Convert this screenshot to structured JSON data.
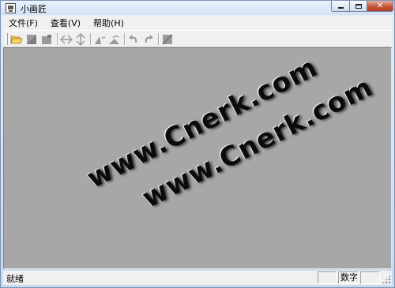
{
  "window": {
    "title": "小画匠"
  },
  "menu": {
    "items": [
      "文件(F)",
      "查看(V)",
      "帮助(H)"
    ]
  },
  "toolbar": {
    "buttons": [
      {
        "name": "open-icon"
      },
      {
        "name": "save-icon"
      },
      {
        "name": "save-as-icon"
      },
      {
        "name": "flip-horizontal-icon"
      },
      {
        "name": "flip-vertical-icon"
      },
      {
        "name": "rotate-left-icon"
      },
      {
        "name": "rotate-right-icon"
      },
      {
        "name": "undo-icon"
      },
      {
        "name": "redo-icon"
      },
      {
        "name": "crop-icon"
      }
    ]
  },
  "canvas": {
    "background": "#a7a7a7",
    "watermark_1": "www.Cnerk.com",
    "watermark_2": "www.Cnerk.com"
  },
  "status": {
    "text": "就绪",
    "pane_num": "数字"
  }
}
